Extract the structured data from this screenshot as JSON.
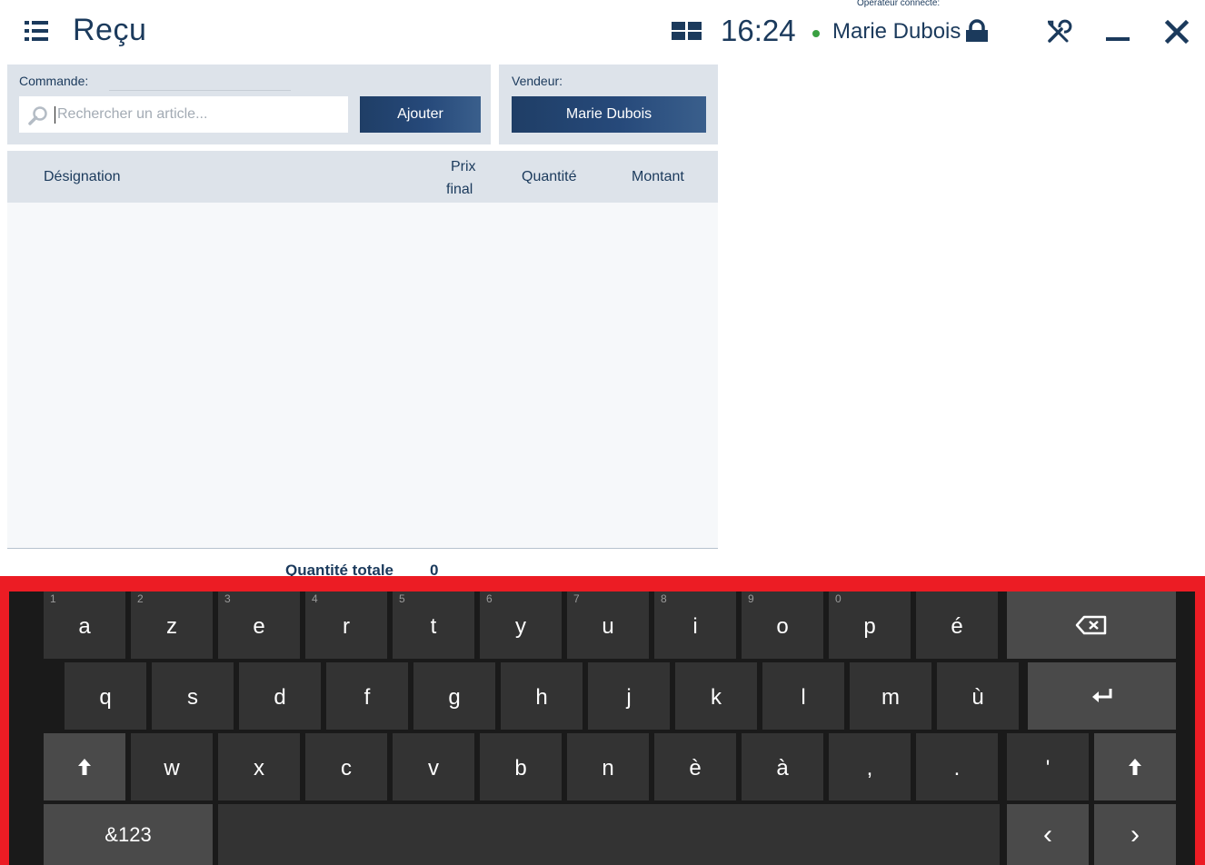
{
  "app": {
    "title": "Reçu",
    "time": "16:24",
    "operator_label": "Opérateur connecté:",
    "operator_name": "Marie Dubois"
  },
  "order": {
    "label": "Commande:",
    "search_placeholder": "Rechercher un article...",
    "add_button": "Ajouter"
  },
  "seller": {
    "label": "Vendeur:",
    "name": "Marie Dubois"
  },
  "table": {
    "columns": [
      "Désignation",
      "Prix",
      "final",
      "Quantité",
      "Montant"
    ]
  },
  "totals": {
    "label": "Quantité totale",
    "quantity": "0"
  },
  "keyboard": {
    "row1": [
      {
        "key": "a",
        "num": "1"
      },
      {
        "key": "z",
        "num": "2"
      },
      {
        "key": "e",
        "num": "3"
      },
      {
        "key": "r",
        "num": "4"
      },
      {
        "key": "t",
        "num": "5"
      },
      {
        "key": "y",
        "num": "6"
      },
      {
        "key": "u",
        "num": "7"
      },
      {
        "key": "i",
        "num": "8"
      },
      {
        "key": "o",
        "num": "9"
      },
      {
        "key": "p",
        "num": "0"
      },
      {
        "key": "é",
        "num": ""
      }
    ],
    "row2": [
      "q",
      "s",
      "d",
      "f",
      "g",
      "h",
      "j",
      "k",
      "l",
      "m",
      "ù"
    ],
    "row3": [
      "w",
      "x",
      "c",
      "v",
      "b",
      "n",
      "è",
      "à",
      ",",
      ".",
      "'"
    ],
    "symbols_label": "&123",
    "left_arrow": "‹",
    "right_arrow": "›",
    "shift_glyph": "🠉",
    "enter_glyph": "↵"
  }
}
